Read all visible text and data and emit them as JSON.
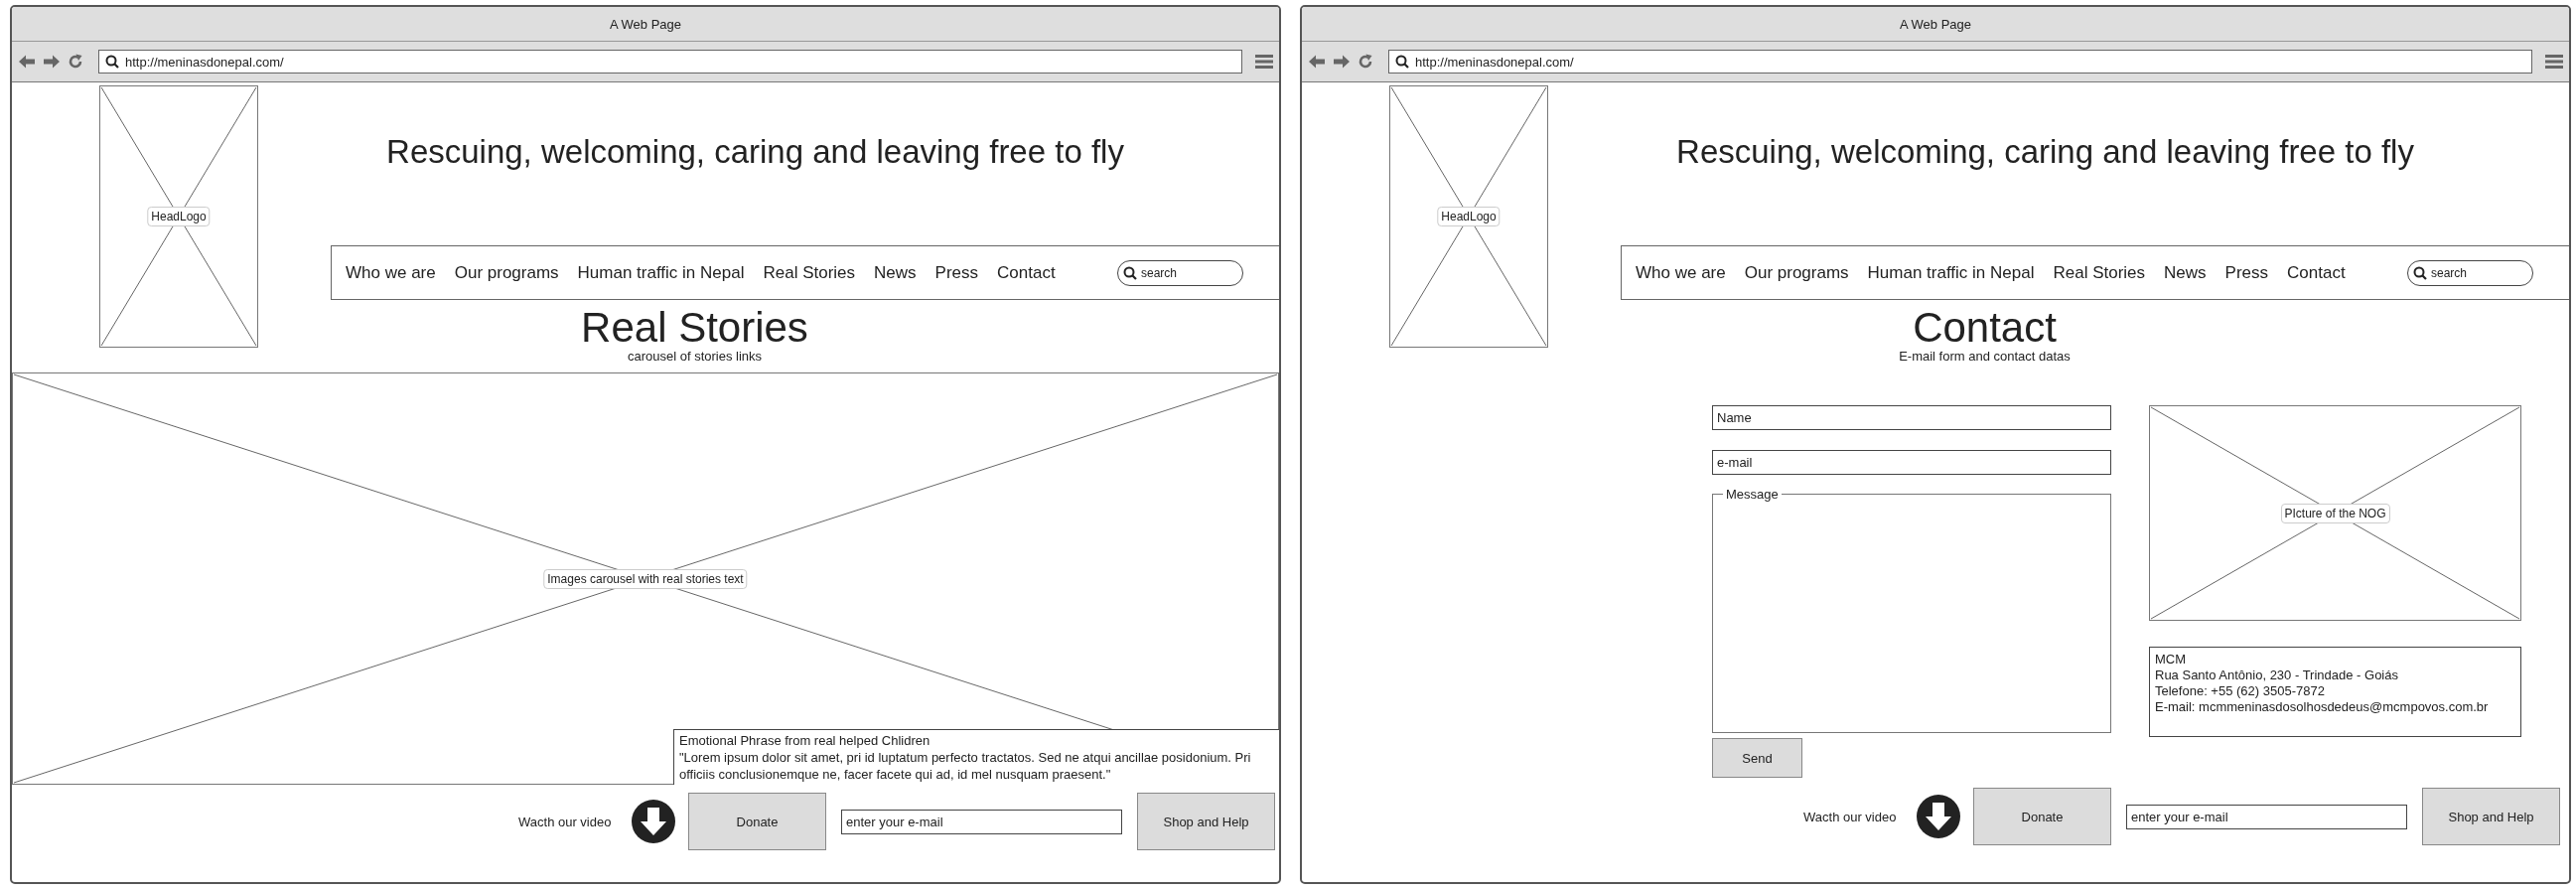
{
  "windows": [
    {
      "kind": "stories",
      "title": "A Web Page",
      "url": "http://meninasdonepal.com/",
      "logo_label": "HeadLogo",
      "tagline": "Rescuing, welcoming, caring and leaving free to fly",
      "nav": {
        "items": [
          "Who we are",
          "Our programs",
          "Human traffic in Nepal",
          "Real Stories",
          "News",
          "Press",
          "Contact"
        ],
        "search_placeholder": "search"
      },
      "page_title": "Real Stories",
      "page_subtitle": "carousel of stories links",
      "carousel": {
        "label": "Images carousel with real stories text",
        "phrase_title": "Emotional Phrase from real helped Chlidren",
        "phrase_text": "\"Lorem ipsum dolor sit amet, pri id luptatum perfecto tractatos. Sed ne atqui ancillae posidonium. Pri officiis conclusionemque ne, facer facete qui ad, id mel nusquam praesent.\""
      },
      "footer": {
        "video_label": "Wacth our video",
        "donate": "Donate",
        "email_placeholder": "enter your e-mail",
        "shop": "Shop and Help"
      }
    },
    {
      "kind": "contact",
      "title": "A Web Page",
      "url": "http://meninasdonepal.com/",
      "logo_label": "HeadLogo",
      "tagline": "Rescuing, welcoming, caring and leaving free to fly",
      "nav": {
        "items": [
          "Who we are",
          "Our programs",
          "Human traffic in Nepal",
          "Real Stories",
          "News",
          "Press",
          "Contact"
        ],
        "search_placeholder": "search"
      },
      "page_title": "Contact",
      "page_subtitle": "E-mail form and contact datas",
      "form": {
        "name_placeholder": "Name",
        "email_placeholder": "e-mail",
        "message_label": "Message",
        "send": "Send"
      },
      "picture_label": "PIcture of the NOG",
      "contact_lines": [
        "MCM",
        "Rua Santo Antônio, 230 - Trindade - Goiás",
        "Telefone: +55 (62) 3505-7872",
        "E-mail: mcmmeninasdosolhosdedeus@mcmpovos.com.br"
      ],
      "footer": {
        "video_label": "Wacth our video",
        "donate": "Donate",
        "email_placeholder": "enter your e-mail",
        "shop": "Shop and Help"
      }
    }
  ]
}
